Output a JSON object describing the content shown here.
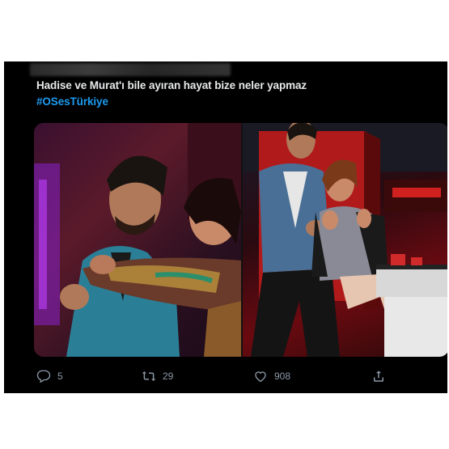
{
  "tweet": {
    "text_line1": "Hadise ve Murat'ı bile ayıran hayat bize neler yapmaz",
    "hashtag": "#OSesTürkiye"
  },
  "actions": {
    "reply_count": "5",
    "retweet_count": "29",
    "like_count": "908"
  },
  "icons": {
    "reply": "reply-icon",
    "retweet": "retweet-icon",
    "like": "like-icon",
    "share": "share-icon"
  },
  "colors": {
    "background": "#000000",
    "text": "#e7e9ea",
    "hashtag": "#1d9bf0",
    "icon": "#8b98a5"
  }
}
